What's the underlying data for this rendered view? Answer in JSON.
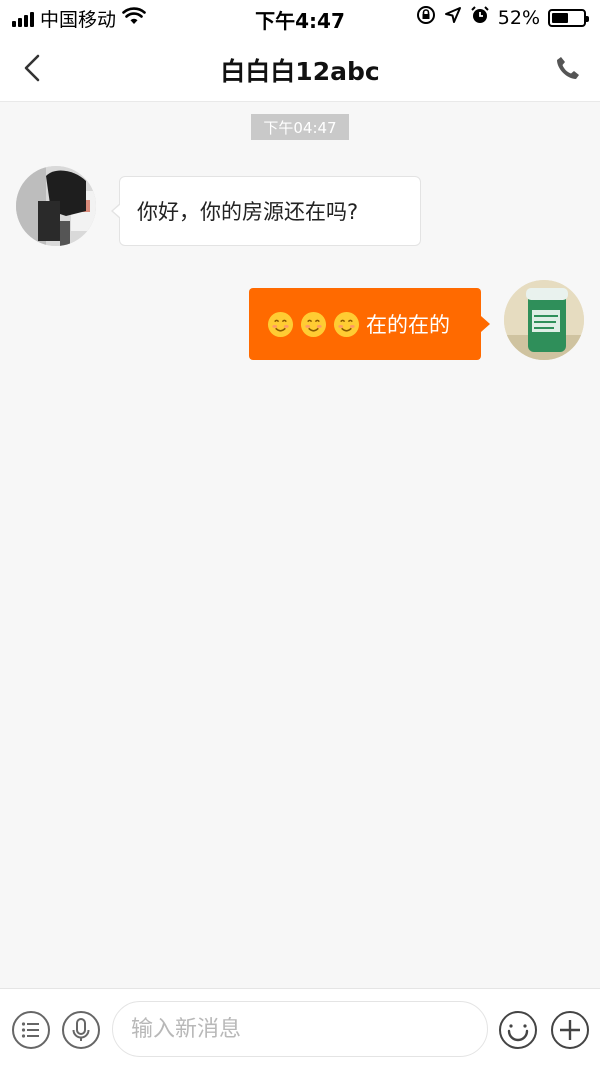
{
  "status_bar": {
    "carrier": "中国移动",
    "time": "下午4:47",
    "battery": "52%",
    "battery_level": 0.52,
    "icons": [
      "signal-icon",
      "wifi-icon",
      "rotation-lock-icon",
      "location-icon",
      "alarm-icon",
      "battery-icon"
    ]
  },
  "header": {
    "title": "白白白12abc",
    "back_icon": "chevron-left-icon",
    "call_icon": "phone-icon"
  },
  "chat": {
    "timestamp": "下午04:47",
    "messages": [
      {
        "direction": "incoming",
        "text": "你好，你的房源还在吗?"
      },
      {
        "direction": "outgoing",
        "emojis": [
          "smile-emoji",
          "smile-emoji",
          "smile-emoji"
        ],
        "text": "在的在的"
      }
    ]
  },
  "input_bar": {
    "placeholder": "输入新消息",
    "value": "",
    "icons": [
      "menu-icon",
      "microphone-icon",
      "emoji-icon",
      "plus-icon"
    ]
  },
  "colors": {
    "accent": "#ff6a00",
    "background": "#f7f7f7",
    "timestamp_bg": "#c9c9c9"
  }
}
